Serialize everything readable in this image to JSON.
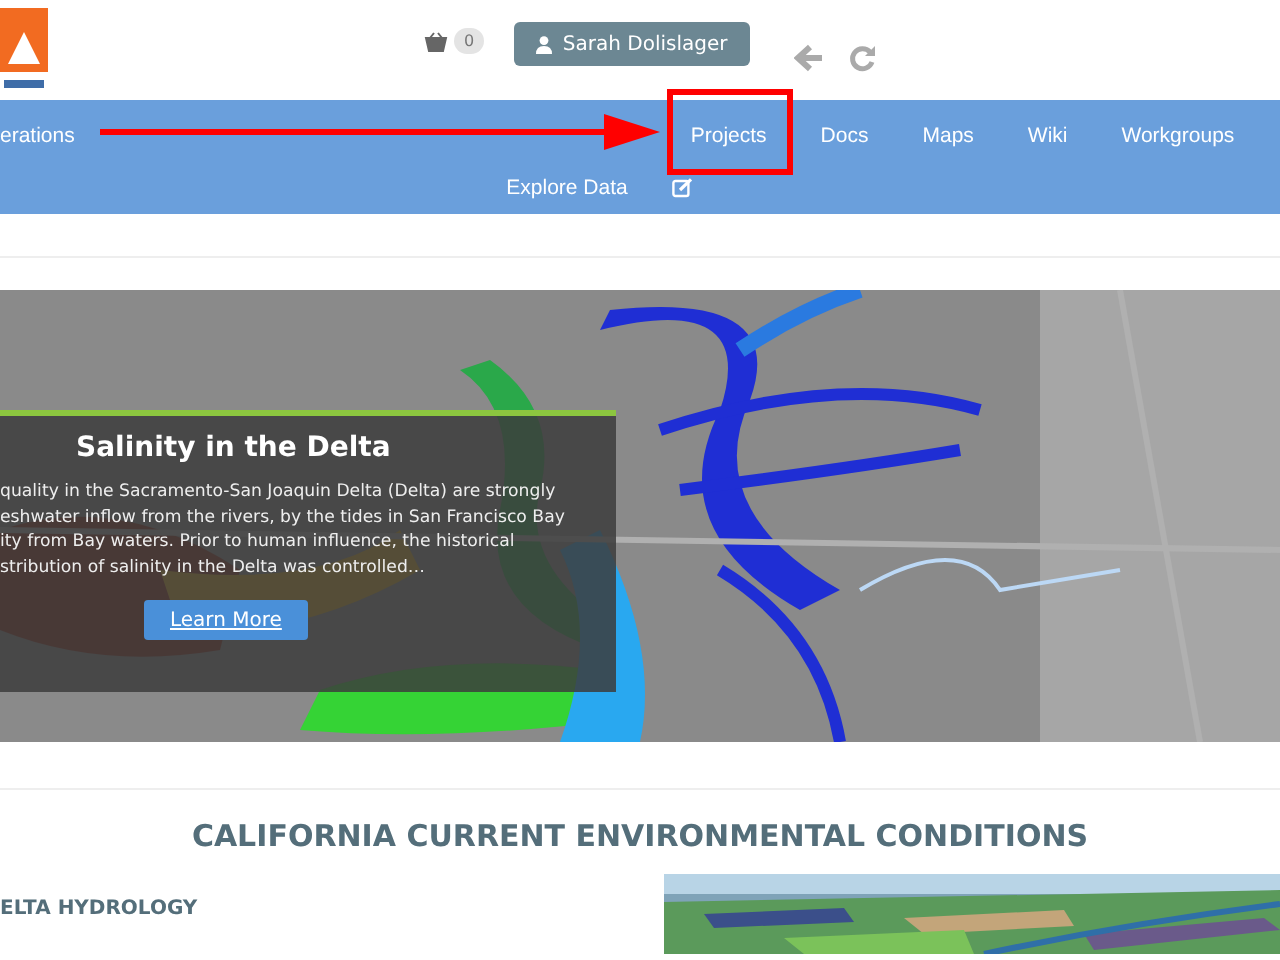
{
  "header": {
    "cart_count": "0",
    "user": "Sarah Dolislager"
  },
  "nav": {
    "items": [
      {
        "label": "erations"
      },
      {
        "label": "Projects"
      },
      {
        "label": "Docs"
      },
      {
        "label": "Maps"
      },
      {
        "label": "Wiki"
      },
      {
        "label": "Workgroups"
      }
    ],
    "second_row": [
      {
        "label": "Explore Data"
      }
    ]
  },
  "hero": {
    "kind": "picture",
    "title": "Salinity in the Delta",
    "lines": [
      "quality in the Sacramento-San Joaquin Delta (Delta) are strongly",
      "eshwater inflow from the rivers, by the tides in San Francisco Bay",
      "ity from Bay waters. Prior to human influence, the historical",
      "stribution of salinity in the Delta was controlled…"
    ],
    "button": "Learn More"
  },
  "conditions": {
    "title": "CALIFORNIA CURRENT ENVIRONMENTAL CONDITIONS",
    "section": "ELTA HYDROLOGY"
  }
}
